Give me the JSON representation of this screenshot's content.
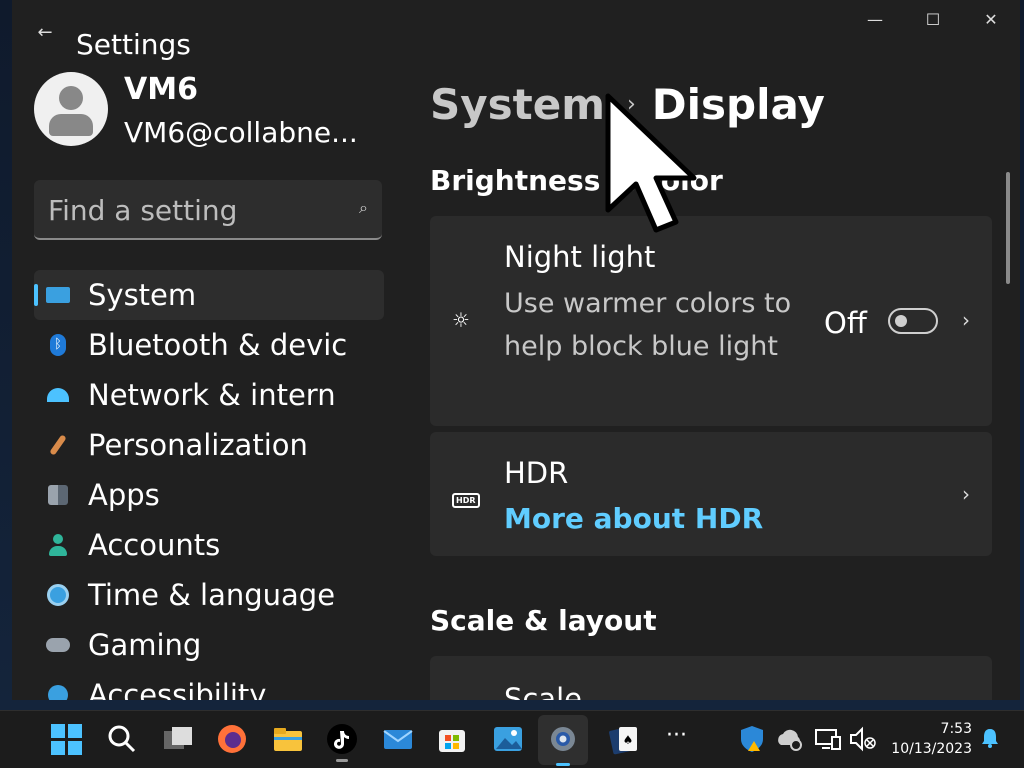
{
  "window": {
    "back_glyph": "←",
    "title": "Settings",
    "controls": {
      "minimize": "—",
      "maximize": "☐",
      "close": "✕"
    }
  },
  "profile": {
    "name": "VM6",
    "email": "VM6@collabne..."
  },
  "search": {
    "placeholder": "Find a setting",
    "icon": "search-icon"
  },
  "sidebar": {
    "items": [
      {
        "label": "System",
        "icon": "monitor-icon",
        "selected": true
      },
      {
        "label": "Bluetooth & devic",
        "icon": "bluetooth-icon"
      },
      {
        "label": "Network & intern",
        "icon": "wifi-icon"
      },
      {
        "label": "Personalization",
        "icon": "paintbrush-icon"
      },
      {
        "label": "Apps",
        "icon": "apps-icon"
      },
      {
        "label": "Accounts",
        "icon": "person-icon"
      },
      {
        "label": "Time & language",
        "icon": "globe-clock-icon"
      },
      {
        "label": "Gaming",
        "icon": "gamepad-icon"
      },
      {
        "label": "Accessibility",
        "icon": "accessibility-icon"
      }
    ]
  },
  "main": {
    "breadcrumb": {
      "parent": "System",
      "separator": "›",
      "current": "Display"
    },
    "section_brightness": "Brightness & color",
    "night_light": {
      "title": "Night light",
      "description": "Use warmer colors to help block blue light",
      "state": "Off",
      "enabled": false
    },
    "hdr": {
      "title": "HDR",
      "link": "More about HDR",
      "badge": "HDR"
    },
    "section_scale": "Scale & layout",
    "scale_card_title": "Scale",
    "chevron": "›"
  },
  "taskbar": {
    "apps": [
      "start-icon",
      "search-icon",
      "task-view-icon",
      "firefox-icon",
      "file-explorer-icon",
      "tiktok-icon",
      "mail-icon",
      "store-icon",
      "photos-icon",
      "settings-icon",
      "solitaire-icon",
      "more-icon"
    ],
    "overflow": "···",
    "clock_time": "7:53",
    "clock_date": "10/13/2023"
  },
  "colors": {
    "accent": "#4cc2ff",
    "link": "#60cdff",
    "window_bg": "#202020",
    "card_bg": "#2b2b2b"
  }
}
